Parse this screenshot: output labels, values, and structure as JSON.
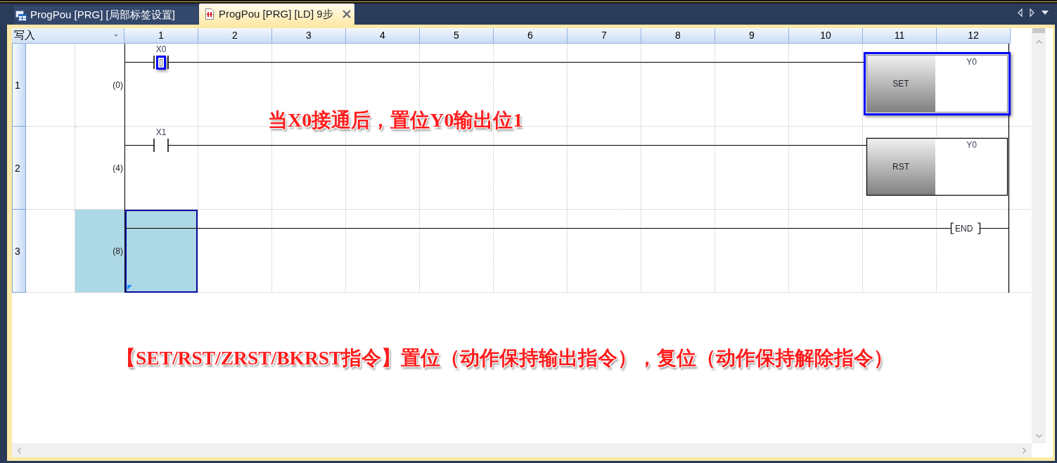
{
  "tabs": [
    {
      "kind": "label-table",
      "label": "ProgPou [PRG] [局部标签设置]",
      "selected": false
    },
    {
      "kind": "ladder",
      "label": "ProgPou [PRG] [LD] 9步",
      "selected": true
    }
  ],
  "editor": {
    "mode": "写入",
    "columns": [
      "1",
      "2",
      "3",
      "4",
      "5",
      "6",
      "7",
      "8",
      "9",
      "10",
      "11",
      "12"
    ],
    "rungs": [
      {
        "number": "1",
        "step": "(0)",
        "selected": false,
        "elements": [
          {
            "kind": "contact",
            "device": "X0",
            "selected": true
          },
          {
            "kind": "instruction",
            "instruction": "SET",
            "operand": "Y0",
            "selected": true
          }
        ]
      },
      {
        "number": "2",
        "step": "(4)",
        "selected": false,
        "elements": [
          {
            "kind": "contact",
            "device": "X1",
            "selected": false
          },
          {
            "kind": "instruction",
            "instruction": "RST",
            "operand": "Y0",
            "selected": false
          }
        ]
      },
      {
        "number": "3",
        "step": "(8)",
        "selected": true,
        "elements": [
          {
            "kind": "end",
            "instruction": "END",
            "selected": false
          }
        ]
      }
    ]
  },
  "annotations": [
    {
      "kind": "overlay",
      "text": "当X0接通后，置位Y0输出位1"
    },
    {
      "kind": "caption",
      "text": "【SET/RST/ZRST/BKRST指令】置位（动作保持输出指令），复位（动作保持解除指令）"
    }
  ]
}
